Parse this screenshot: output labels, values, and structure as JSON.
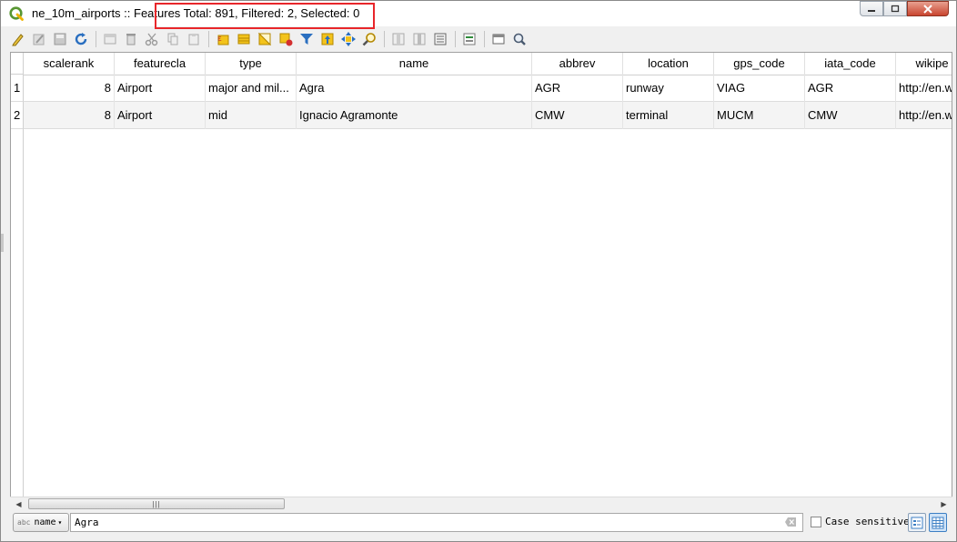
{
  "window": {
    "title": "ne_10m_airports :: Features Total: 891, Filtered: 2, Selected: 0"
  },
  "toolbar": {
    "buttons": [
      "edit-pencil-icon",
      "multi-edit-icon",
      "save-edits-icon",
      "reload-icon",
      "add-feature-icon",
      "delete-feature-icon",
      "cut-icon",
      "copy-icon",
      "paste-icon",
      "select-by-expression-icon",
      "select-all-icon",
      "invert-selection-icon",
      "deselect-icon",
      "filter-select-icon",
      "move-selection-top-icon",
      "pan-to-selection-icon",
      "zoom-to-selection-icon",
      "new-field-icon",
      "delete-field-icon",
      "field-calculator-icon",
      "conditional-format-icon",
      "dock-icon",
      "actions-icon"
    ]
  },
  "table": {
    "columns": [
      "scalerank",
      "featurecla",
      "type",
      "name",
      "abbrev",
      "location",
      "gps_code",
      "iata_code",
      "wikipe"
    ],
    "rows": [
      {
        "id": "1",
        "cells": [
          "8",
          "Airport",
          "major and mil...",
          "Agra",
          "AGR",
          "runway",
          "VIAG",
          "AGR",
          "http://en.w"
        ]
      },
      {
        "id": "2",
        "cells": [
          "8",
          "Airport",
          "mid",
          "Ignacio Agramonte",
          "CMW",
          "terminal",
          "MUCM",
          "CMW",
          "http://en.w"
        ]
      }
    ]
  },
  "filter": {
    "field_tag": "abc",
    "field_name": "name",
    "value": "Agra",
    "case_sensitive_label": "Case sensitive",
    "case_sensitive_checked": false
  },
  "colors": {
    "highlight": "#e8262a",
    "selection_blue": "#3c7fc4",
    "qgis_green": "#589632"
  }
}
